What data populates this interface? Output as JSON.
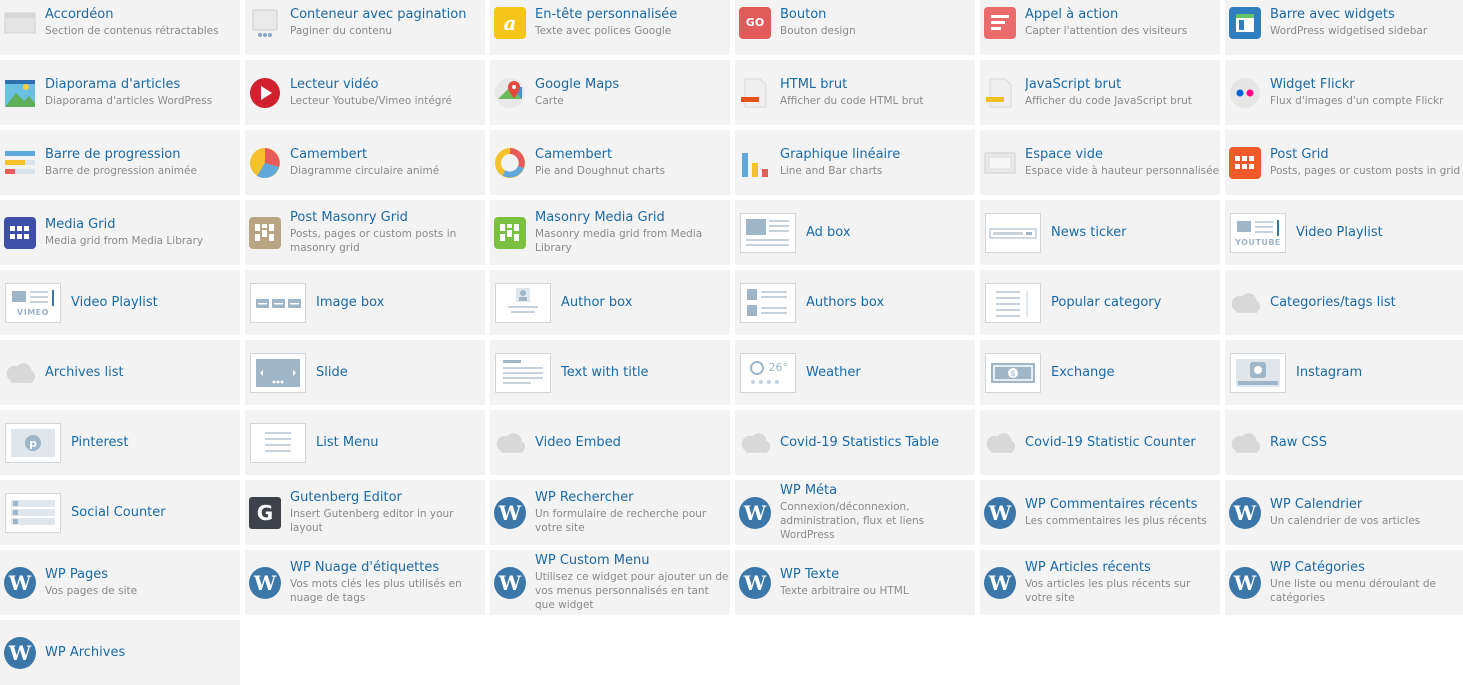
{
  "widgets": [
    {
      "title": "Accordéon",
      "desc": "Section de contenus rétractables",
      "icon": "accordion-icon"
    },
    {
      "title": "Conteneur avec pagination",
      "desc": "Paginer du contenu",
      "icon": "pagination-icon"
    },
    {
      "title": "En-tête personnalisée",
      "desc": "Texte avec polices Google",
      "icon": "heading-icon"
    },
    {
      "title": "Bouton",
      "desc": "Bouton design",
      "icon": "button-icon"
    },
    {
      "title": "Appel à action",
      "desc": "Capter l'attention des visiteurs",
      "icon": "call-to-action-icon"
    },
    {
      "title": "Barre avec widgets",
      "desc": "WordPress widgetised sidebar",
      "icon": "sidebar-icon"
    },
    {
      "title": "Diaporama d'articles",
      "desc": "Diaporama d'articles WordPress",
      "icon": "slideshow-icon"
    },
    {
      "title": "Lecteur vidéo",
      "desc": "Lecteur Youtube/Vimeo intégré",
      "icon": "video-player-icon"
    },
    {
      "title": "Google Maps",
      "desc": "Carte",
      "icon": "google-maps-icon"
    },
    {
      "title": "HTML brut",
      "desc": "Afficher du code HTML brut",
      "icon": "html-file-icon"
    },
    {
      "title": "JavaScript brut",
      "desc": "Afficher du code JavaScript brut",
      "icon": "js-file-icon"
    },
    {
      "title": "Widget Flickr",
      "desc": "Flux d'images d'un compte Flickr",
      "icon": "flickr-icon"
    },
    {
      "title": "Barre de progression",
      "desc": "Barre de progression animée",
      "icon": "progress-bar-icon"
    },
    {
      "title": "Camembert",
      "desc": "Diagramme circulaire animé",
      "icon": "pie-chart-icon"
    },
    {
      "title": "Camembert",
      "desc": "Pie and Doughnut charts",
      "icon": "doughnut-chart-icon"
    },
    {
      "title": "Graphique linéaire",
      "desc": "Line and Bar charts",
      "icon": "bar-chart-icon"
    },
    {
      "title": "Espace vide",
      "desc": "Espace vide à hauteur personnalisée",
      "icon": "empty-space-icon"
    },
    {
      "title": "Post Grid",
      "desc": "Posts, pages or custom posts in grid",
      "icon": "post-grid-icon"
    },
    {
      "title": "Media Grid",
      "desc": "Media grid from Media Library",
      "icon": "media-grid-icon"
    },
    {
      "title": "Post Masonry Grid",
      "desc": "Posts, pages or custom posts in masonry grid",
      "icon": "masonry-grid-icon"
    },
    {
      "title": "Masonry Media Grid",
      "desc": "Masonry media grid from Media Library",
      "icon": "masonry-media-grid-icon"
    },
    {
      "title": "Ad box",
      "desc": "",
      "icon": "ad-box-icon"
    },
    {
      "title": "News ticker",
      "desc": "",
      "icon": "news-ticker-icon"
    },
    {
      "title": "Video Playlist",
      "desc": "",
      "icon": "youtube-playlist-icon",
      "badge": "YOUTUBE"
    },
    {
      "title": "Video Playlist",
      "desc": "",
      "icon": "vimeo-playlist-icon",
      "badge": "VIMEO"
    },
    {
      "title": "Image box",
      "desc": "",
      "icon": "image-box-icon"
    },
    {
      "title": "Author box",
      "desc": "",
      "icon": "author-box-icon"
    },
    {
      "title": "Authors box",
      "desc": "",
      "icon": "authors-box-icon"
    },
    {
      "title": "Popular category",
      "desc": "",
      "icon": "popular-category-icon"
    },
    {
      "title": "Categories/tags list",
      "desc": "",
      "icon": "cloud-icon"
    },
    {
      "title": "Archives list",
      "desc": "",
      "icon": "cloud-icon"
    },
    {
      "title": "Slide",
      "desc": "",
      "icon": "slide-icon"
    },
    {
      "title": "Text with title",
      "desc": "",
      "icon": "text-title-icon"
    },
    {
      "title": "Weather",
      "desc": "",
      "icon": "weather-icon",
      "badge": "26°"
    },
    {
      "title": "Exchange",
      "desc": "",
      "icon": "exchange-icon"
    },
    {
      "title": "Instagram",
      "desc": "",
      "icon": "instagram-icon"
    },
    {
      "title": "Pinterest",
      "desc": "",
      "icon": "pinterest-icon"
    },
    {
      "title": "List Menu",
      "desc": "",
      "icon": "list-menu-icon"
    },
    {
      "title": "Video Embed",
      "desc": "",
      "icon": "cloud-icon"
    },
    {
      "title": "Covid-19 Statistics Table",
      "desc": "",
      "icon": "cloud-icon"
    },
    {
      "title": "Covid-19 Statistic Counter",
      "desc": "",
      "icon": "cloud-icon"
    },
    {
      "title": "Raw CSS",
      "desc": "",
      "icon": "cloud-icon"
    },
    {
      "title": "Social Counter",
      "desc": "",
      "icon": "social-counter-icon"
    },
    {
      "title": "Gutenberg Editor",
      "desc": "Insert Gutenberg editor in your layout",
      "icon": "gutenberg-icon"
    },
    {
      "title": "WP Rechercher",
      "desc": "Un formulaire de recherche pour votre site",
      "icon": "wordpress-icon"
    },
    {
      "title": "WP Méta",
      "desc": "Connexion/déconnexion, administration, flux et liens WordPress",
      "icon": "wordpress-icon"
    },
    {
      "title": "WP Commentaires récents",
      "desc": "Les commentaires les plus récents",
      "icon": "wordpress-icon"
    },
    {
      "title": "WP Calendrier",
      "desc": "Un calendrier de vos articles",
      "icon": "wordpress-icon"
    },
    {
      "title": "WP Pages",
      "desc": "Vos pages de site",
      "icon": "wordpress-icon"
    },
    {
      "title": "WP Nuage d'étiquettes",
      "desc": "Vos mots clés les plus utilisés en nuage de tags",
      "icon": "wordpress-icon"
    },
    {
      "title": "WP Custom Menu",
      "desc": "Utilisez ce widget pour ajouter un de vos menus personnalisés en tant que widget",
      "icon": "wordpress-icon"
    },
    {
      "title": "WP Texte",
      "desc": "Texte arbitraire ou HTML",
      "icon": "wordpress-icon"
    },
    {
      "title": "WP Articles récents",
      "desc": "Vos articles les plus récents sur votre site",
      "icon": "wordpress-icon"
    },
    {
      "title": "WP Catégories",
      "desc": "Une liste ou menu déroulant de catégories",
      "icon": "wordpress-icon"
    },
    {
      "title": "WP Archives",
      "desc": "",
      "icon": "wordpress-icon"
    }
  ]
}
